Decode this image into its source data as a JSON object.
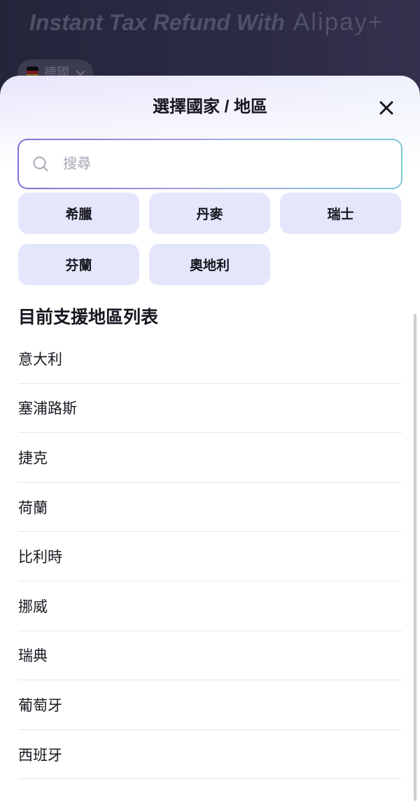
{
  "background": {
    "headline": "Instant Tax Refund With",
    "logo_text": "Alipay+",
    "current_country": {
      "label": "德國",
      "flag_icon": "germany-flag-icon",
      "chevron_icon": "chevron-down-icon"
    }
  },
  "sheet": {
    "title": "選擇國家 / 地區",
    "close_icon": "close-icon"
  },
  "search": {
    "icon": "search-icon",
    "placeholder": "搜尋"
  },
  "popular": {
    "items": [
      {
        "label": "希臘"
      },
      {
        "label": "丹麥"
      },
      {
        "label": "瑞士"
      },
      {
        "label": "芬蘭"
      },
      {
        "label": "奧地利"
      }
    ]
  },
  "list": {
    "heading": "目前支援地區列表",
    "items": [
      {
        "label": "意大利"
      },
      {
        "label": "塞浦路斯"
      },
      {
        "label": "捷克"
      },
      {
        "label": "荷蘭"
      },
      {
        "label": "比利時"
      },
      {
        "label": "挪威"
      },
      {
        "label": "瑞典"
      },
      {
        "label": "葡萄牙"
      },
      {
        "label": "西班牙"
      }
    ]
  },
  "colors": {
    "backdrop": "#26283f",
    "search_border_start": "#7d70d6",
    "search_border_end": "#7ccbd9",
    "chip_background": "#e4e7fb",
    "text_primary": "#16161f",
    "placeholder": "#a5a5b5",
    "divider": "#e6e6ec"
  }
}
